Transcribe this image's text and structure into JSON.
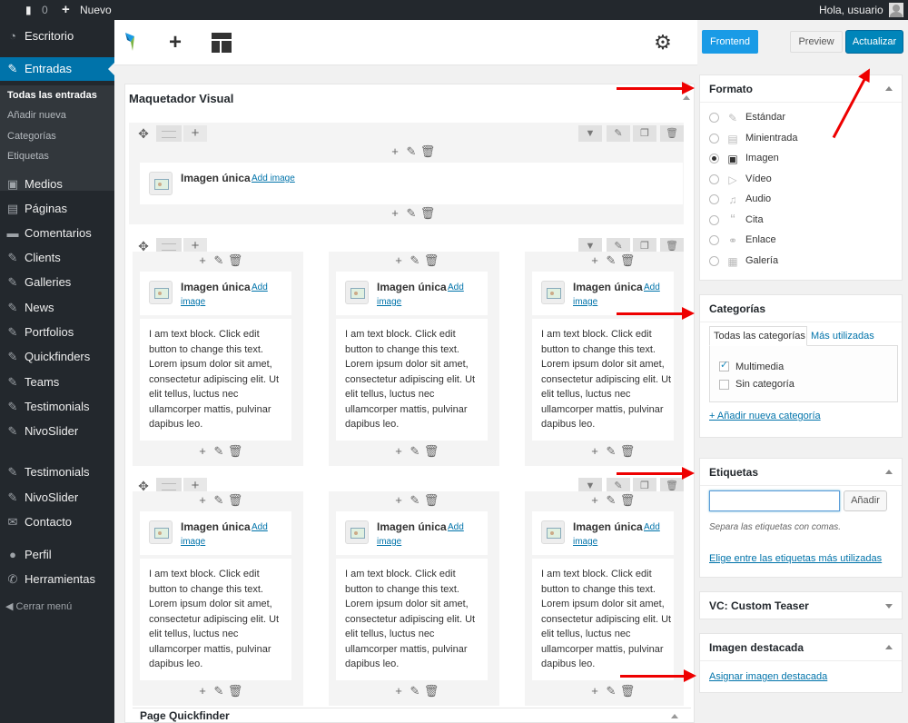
{
  "adminbar": {
    "comments_count": "0",
    "new_label": "Nuevo",
    "greeting": "Hola, usuario"
  },
  "sidebar": {
    "items": [
      {
        "label": "Escritorio",
        "icon": "dashboard-icon"
      },
      {
        "label": "Entradas",
        "icon": "pin-icon"
      },
      {
        "label": "Medios",
        "icon": "media-icon"
      },
      {
        "label": "Páginas",
        "icon": "pages-icon"
      },
      {
        "label": "Comentarios",
        "icon": "comments-icon"
      },
      {
        "label": "Clients",
        "icon": "pin-icon"
      },
      {
        "label": "Galleries",
        "icon": "pin-icon"
      },
      {
        "label": "News",
        "icon": "pin-icon"
      },
      {
        "label": "Portfolios",
        "icon": "pin-icon"
      },
      {
        "label": "Quickfinders",
        "icon": "pin-icon"
      },
      {
        "label": "Teams",
        "icon": "pin-icon"
      },
      {
        "label": "Testimonials",
        "icon": "pin-icon"
      },
      {
        "label": "NivoSlider",
        "icon": "pin-icon"
      },
      {
        "label": "Testimonials",
        "icon": "pin-icon"
      },
      {
        "label": "NivoSlider",
        "icon": "pin-icon"
      },
      {
        "label": "Contacto",
        "icon": "mail-icon"
      },
      {
        "label": "Perfil",
        "icon": "user-icon"
      },
      {
        "label": "Herramientas",
        "icon": "wrench-icon"
      }
    ],
    "submenu": [
      "Todas las entradas",
      "Añadir nueva",
      "Categorías",
      "Etiquetas"
    ],
    "collapse_label": "Cerrar menú"
  },
  "toolbar": {
    "frontend_label": "Frontend",
    "preview_label": "Preview",
    "update_label": "Actualizar"
  },
  "builder": {
    "title": "Maquetador Visual",
    "element_name": "Imagen única",
    "add_image_label": "Add image",
    "text_block": "I am text block. Click edit button to change this text. Lorem ipsum dolor sit amet, consectetur adipiscing elit. Ut elit tellus, luctus nec ullamcorper mattis, pulvinar dapibus leo.",
    "quickfinder_title": "Page Quickfinder"
  },
  "formato": {
    "title": "Formato",
    "options": [
      {
        "label": "Estándar",
        "icon": "pin-icon",
        "checked": false
      },
      {
        "label": "Minientrada",
        "icon": "aside-icon",
        "checked": false
      },
      {
        "label": "Imagen",
        "icon": "image-icon",
        "checked": true
      },
      {
        "label": "Vídeo",
        "icon": "video-icon",
        "checked": false
      },
      {
        "label": "Audio",
        "icon": "audio-icon",
        "checked": false
      },
      {
        "label": "Cita",
        "icon": "quote-icon",
        "checked": false
      },
      {
        "label": "Enlace",
        "icon": "link-icon",
        "checked": false
      },
      {
        "label": "Galería",
        "icon": "gallery-icon",
        "checked": false
      }
    ]
  },
  "categorias": {
    "title": "Categorías",
    "tab_all": "Todas las categorías",
    "tab_popular": "Más utilizadas",
    "items": [
      {
        "label": "Multimedia",
        "checked": true
      },
      {
        "label": "Sin categoría",
        "checked": false
      }
    ],
    "add_link": "+ Añadir nueva categoría"
  },
  "etiquetas": {
    "title": "Etiquetas",
    "input_value": "",
    "add_button": "Añadir",
    "hint": "Separa las etiquetas con comas.",
    "choose_link": "Elige entre las etiquetas más utilizadas"
  },
  "custom_teaser": {
    "title": "VC: Custom Teaser"
  },
  "imagen_destacada": {
    "title": "Imagen destacada",
    "link": "Asignar imagen destacada"
  },
  "colors": {
    "accent": "#0073aa",
    "arrow": "#e00000"
  }
}
